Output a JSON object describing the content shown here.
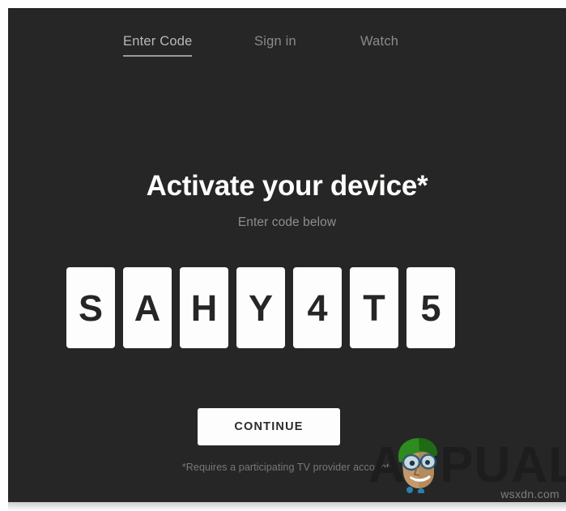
{
  "panel": {
    "background_color": "#262626",
    "surface_color": "#fdfdfd"
  },
  "topnav": {
    "items": [
      {
        "label": "Enter Code",
        "active": true
      },
      {
        "label": "Sign in",
        "active": false
      },
      {
        "label": "Watch",
        "active": false
      }
    ]
  },
  "main": {
    "headline": "Activate your device*",
    "subtitle": "Enter code below",
    "code": {
      "characters": [
        "S",
        "A",
        "H",
        "Y",
        "4",
        "T",
        "5"
      ],
      "value": "SAHY4T5",
      "length": 7
    },
    "continue_label": "CONTINUE",
    "footnote": "*Requires a participating TV provider account."
  },
  "watermarks": {
    "brand_text": "APPUALS",
    "brand_logo_name": "appuals-mascot-logo",
    "site_text": "wsxdn.com"
  }
}
